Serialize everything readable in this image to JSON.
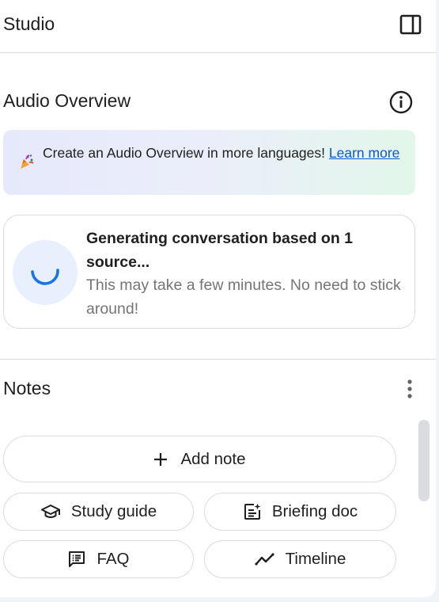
{
  "studio": {
    "title": "Studio",
    "panel_toggle_icon": "side-panel-icon"
  },
  "audio_overview": {
    "title": "Audio Overview",
    "info_icon": "info-icon",
    "banner": {
      "icon": "party-popper-icon",
      "text": "Create an Audio Overview in more languages!",
      "link_label": "Learn more"
    },
    "generating": {
      "title": "Generating conversation based on 1 source...",
      "subtitle": "This may take a few minutes. No need to stick around!",
      "spinner_icon": "loading-spinner-icon"
    }
  },
  "notes": {
    "title": "Notes",
    "more_icon": "more-vert-icon",
    "add_note_label": "Add note",
    "actions": [
      {
        "label": "Study guide",
        "icon": "school-cap-icon"
      },
      {
        "label": "Briefing doc",
        "icon": "briefing-doc-icon"
      },
      {
        "label": "FAQ",
        "icon": "faq-icon"
      },
      {
        "label": "Timeline",
        "icon": "timeline-icon"
      }
    ]
  },
  "colors": {
    "accent": "#0b57d0",
    "text": "#1f1f1f",
    "muted_text": "#757575",
    "border": "#dadce0",
    "spinner_bg": "#e8f0fe",
    "spinner": "#1a73e8"
  }
}
